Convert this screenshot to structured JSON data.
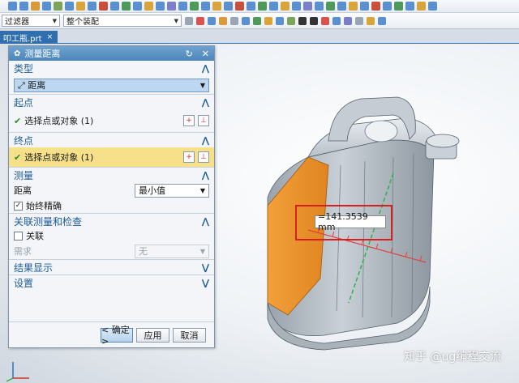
{
  "toolbar": {
    "filter_label": "过滤器",
    "assembly_label": "整个装配"
  },
  "tab": {
    "label": "叩工瓶.prt"
  },
  "dialog": {
    "title": "测量距离",
    "type_section": {
      "title": "类型",
      "value": "距离"
    },
    "start_section": {
      "title": "起点",
      "select_label": "选择点或对象 (1)"
    },
    "end_section": {
      "title": "终点",
      "select_label": "选择点或对象 (1)"
    },
    "measure_section": {
      "title": "测量",
      "distance_label": "距离",
      "distance_value": "最小值",
      "always_accurate_label": "始终精确",
      "always_accurate_checked": true
    },
    "assoc_section": {
      "title": "关联测量和检查",
      "assoc_label": "关联",
      "assoc_checked": false,
      "requirement_label": "需求",
      "requirement_value": "无"
    },
    "result_section": {
      "title": "结果显示"
    },
    "settings_section": {
      "title": "设置"
    },
    "buttons": {
      "ok": "< 确定 >",
      "apply": "应用",
      "cancel": "取消"
    }
  },
  "measurement": {
    "label": "=141.3539 mm"
  },
  "watermark": "知乎 @ug编程交流",
  "colors": {
    "accent": "#4d86bb",
    "section_title": "#1d5c95",
    "highlight_row": "#f7e08a",
    "selected_face": "#f39a2c",
    "measure_box": "#d42020"
  }
}
